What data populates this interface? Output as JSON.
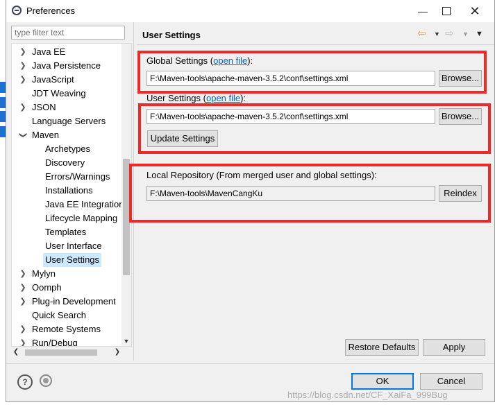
{
  "window": {
    "title": "Preferences"
  },
  "filter": {
    "placeholder": "type filter text"
  },
  "tree": {
    "items": [
      {
        "label": "Java EE",
        "expanded": false
      },
      {
        "label": "Java Persistence",
        "expanded": false
      },
      {
        "label": "JavaScript",
        "expanded": false
      },
      {
        "label": "JDT Weaving",
        "leaf": true
      },
      {
        "label": "JSON",
        "expanded": false
      },
      {
        "label": "Language Servers",
        "leaf": true
      },
      {
        "label": "Maven",
        "expanded": true
      },
      {
        "label": "Archetypes",
        "child": true
      },
      {
        "label": "Discovery",
        "child": true
      },
      {
        "label": "Errors/Warnings",
        "child": true
      },
      {
        "label": "Installations",
        "child": true
      },
      {
        "label": "Java EE Integration",
        "child": true
      },
      {
        "label": "Lifecycle Mapping",
        "child": true
      },
      {
        "label": "Templates",
        "child": true
      },
      {
        "label": "User Interface",
        "child": true
      },
      {
        "label": "User Settings",
        "child": true,
        "selected": true
      },
      {
        "label": "Mylyn",
        "expanded": false
      },
      {
        "label": "Oomph",
        "expanded": false
      },
      {
        "label": "Plug-in Development",
        "expanded": false
      },
      {
        "label": "Quick Search",
        "leaf": true
      },
      {
        "label": "Remote Systems",
        "expanded": false
      },
      {
        "label": "Run/Debug",
        "expanded": false
      }
    ]
  },
  "page": {
    "title": "User Settings",
    "global_settings": {
      "label_prefix": "Global Settings (",
      "link": "open file",
      "label_suffix": "):",
      "value": "F:\\Maven-tools\\apache-maven-3.5.2\\conf\\settings.xml",
      "browse_label": "Browse..."
    },
    "user_settings": {
      "label_prefix": "User Settings (",
      "link": "open file",
      "label_suffix": "):",
      "value": "F:\\Maven-tools\\apache-maven-3.5.2\\conf\\settings.xml",
      "browse_label": "Browse...",
      "update_label": "Update Settings"
    },
    "local_repository": {
      "label": "Local Repository (From merged user and global settings):",
      "value": "F:\\Maven-tools\\MavenCangKu",
      "reindex_label": "Reindex"
    },
    "restore_defaults_label": "Restore Defaults",
    "apply_label": "Apply"
  },
  "footer": {
    "ok_label": "OK",
    "cancel_label": "Cancel",
    "help_glyph": "?"
  },
  "watermark": "https://blog.csdn.net/CF_XaiFa_999Bug",
  "colors": {
    "annotation_red": "#f02828",
    "selection": "#cce8ff",
    "link": "#0066cc",
    "default_button_border": "#0078d7"
  }
}
